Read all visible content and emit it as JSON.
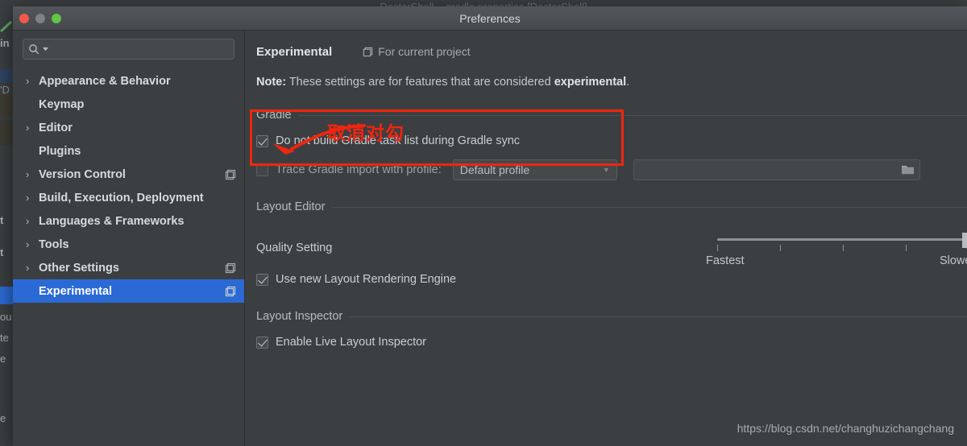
{
  "background_window": {
    "title": "DoctorShell – gradle.properties [DoctorShell]"
  },
  "dialog": {
    "title": "Preferences",
    "traffic_lights": [
      "close",
      "minimize",
      "zoom"
    ]
  },
  "search": {
    "value": "",
    "placeholder": "",
    "icon": "search-icon"
  },
  "sidebar": {
    "items": [
      {
        "label": "Appearance & Behavior",
        "expandable": true,
        "selected": false,
        "scope_icon": false
      },
      {
        "label": "Keymap",
        "expandable": false,
        "selected": false,
        "scope_icon": false
      },
      {
        "label": "Editor",
        "expandable": true,
        "selected": false,
        "scope_icon": false
      },
      {
        "label": "Plugins",
        "expandable": false,
        "selected": false,
        "scope_icon": false
      },
      {
        "label": "Version Control",
        "expandable": true,
        "selected": false,
        "scope_icon": true
      },
      {
        "label": "Build, Execution, Deployment",
        "expandable": true,
        "selected": false,
        "scope_icon": false
      },
      {
        "label": "Languages & Frameworks",
        "expandable": true,
        "selected": false,
        "scope_icon": false
      },
      {
        "label": "Tools",
        "expandable": true,
        "selected": false,
        "scope_icon": false
      },
      {
        "label": "Other Settings",
        "expandable": true,
        "selected": false,
        "scope_icon": true
      },
      {
        "label": "Experimental",
        "expandable": false,
        "selected": true,
        "scope_icon": true
      }
    ]
  },
  "content": {
    "header_title": "Experimental",
    "header_scope": "For current project",
    "note_prefix": "Note:",
    "note_body": " These settings are for features that are considered ",
    "note_emphasis": "experimental",
    "note_suffix": ".",
    "gradle": {
      "group_label": "Gradle",
      "do_not_build": {
        "label": "Do not build Gradle task list during Gradle sync",
        "checked": true,
        "enabled": true
      },
      "trace": {
        "label": "Trace Gradle import with profile:",
        "checked": false,
        "enabled": false,
        "profile_value": "Default profile",
        "profile_options": [
          "Default profile"
        ],
        "path_value": "",
        "browse_icon": "folder-icon"
      }
    },
    "layout_editor": {
      "group_label": "Layout Editor",
      "quality_label": "Quality Setting",
      "quality_min_label": "Fastest",
      "quality_max_label": "Slowest",
      "quality_value": 5,
      "quality_ticks": 5,
      "new_engine": {
        "label": "Use new Layout Rendering Engine",
        "checked": true
      }
    },
    "layout_inspector": {
      "group_label": "Layout Inspector",
      "live_inspector": {
        "label": "Enable Live Layout Inspector",
        "checked": true
      }
    }
  },
  "annotation": {
    "text": "取消对勾",
    "color": "#f0250f",
    "target": "do-not-build-checkbox"
  },
  "watermark": "https://blog.csdn.net/changhuzichangchang",
  "colors": {
    "window_bg": "#3c3f41",
    "titlebar_top": "#53565a",
    "selection_blue": "#2b6ad4",
    "annotation_red": "#f0250f",
    "text_primary": "#c9ced2"
  }
}
